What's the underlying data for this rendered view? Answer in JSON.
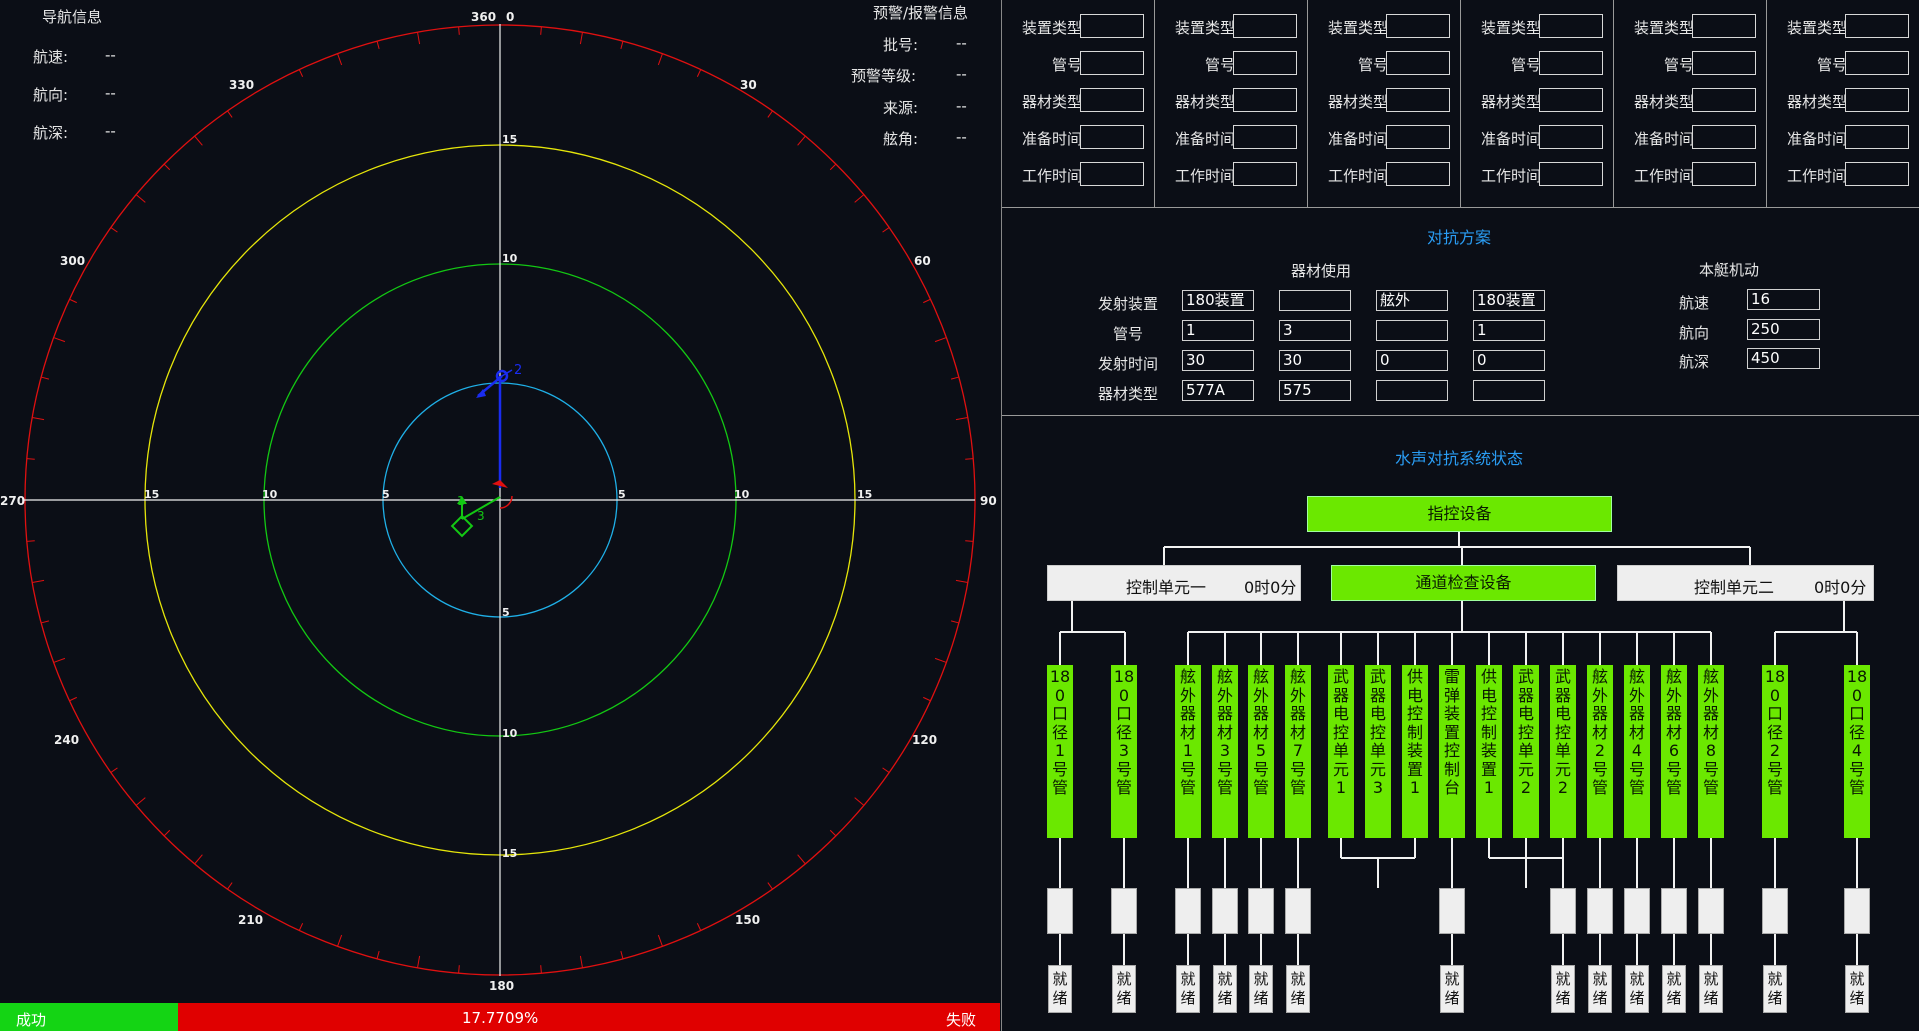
{
  "nav": {
    "title": "导航信息",
    "speed_label": "航速:",
    "speed_value": "--",
    "heading_label": "航向:",
    "heading_value": "--",
    "depth_label": "航深:",
    "depth_value": "--"
  },
  "warn": {
    "title": "预警/报警信息",
    "batch_label": "批号:",
    "batch_value": "--",
    "level_label": "预警等级:",
    "level_value": "--",
    "source_label": "来源:",
    "source_value": "--",
    "angle_label": "舷角:",
    "angle_value": "--"
  },
  "radar": {
    "bearings": [
      "360",
      "0",
      "30",
      "60",
      "90",
      "120",
      "150",
      "180",
      "210",
      "240",
      "270",
      "300",
      "330"
    ],
    "ranges": [
      "5",
      "10",
      "15"
    ],
    "ring_colors": {
      "r5": "#1fb0e8",
      "r10": "#13c813",
      "r15": "#e6e60a",
      "outer": "#e01010"
    },
    "targets": {
      "blue_id": "2",
      "green_id_a": "1",
      "green_id_b": "3"
    }
  },
  "status": {
    "success": "成功",
    "percent": "17.7709%",
    "fail": "失败",
    "progress": 0.177709
  },
  "devices": {
    "labels": {
      "type": "装置类型",
      "tube": "管号",
      "equip": "器材类型",
      "prep": "准备时间",
      "work": "工作时间"
    },
    "count": 6
  },
  "plan": {
    "title": "对抗方案",
    "equip_use_title": "器材使用",
    "row_labels": [
      "发射装置",
      "管号",
      "发射时间",
      "器材类型"
    ],
    "columns": [
      [
        "180装置",
        "1",
        "30",
        "577A"
      ],
      [
        "",
        "3",
        "30",
        "575"
      ],
      [
        "舷外",
        "",
        "0",
        ""
      ],
      [
        "180装置",
        "1",
        "0",
        ""
      ]
    ],
    "maneuver_title": "本艇机动",
    "speed_label": "航速",
    "speed_value": "16",
    "heading_label": "航向",
    "heading_value": "250",
    "depth_label": "航深",
    "depth_value": "450"
  },
  "system": {
    "title": "水声对抗系统状态",
    "command": "指控设备",
    "unit1": "控制单元一",
    "unit1_time": "0时0分",
    "channel": "通道检查设备",
    "unit2": "控制单元二",
    "unit2_time": "0时0分",
    "leaves": [
      {
        "name": "180口径1号管",
        "ready": "就绪"
      },
      {
        "name": "180口径3号管",
        "ready": "就绪"
      },
      {
        "name": "舷外器材1号管",
        "ready": "就绪"
      },
      {
        "name": "舷外器材3号管",
        "ready": "就绪"
      },
      {
        "name": "舷外器材5号管",
        "ready": "就绪"
      },
      {
        "name": "舷外器材7号管",
        "ready": "就绪"
      },
      {
        "name": "武器电控单元1",
        "ready": ""
      },
      {
        "name": "武器电控单元3",
        "ready": ""
      },
      {
        "name": "供电控制装置1",
        "ready": ""
      },
      {
        "name": "雷弹装置控制台",
        "ready": "就绪"
      },
      {
        "name": "供电控制装置1",
        "ready": ""
      },
      {
        "name": "武器电控单元2",
        "ready": ""
      },
      {
        "name": "武器电控单元2",
        "ready": "就绪"
      },
      {
        "name": "舷外器材2号管",
        "ready": "就绪"
      },
      {
        "name": "舷外器材4号管",
        "ready": "就绪"
      },
      {
        "name": "舷外器材6号管",
        "ready": "就绪"
      },
      {
        "name": "舷外器材8号管",
        "ready": "就绪"
      },
      {
        "name": "180口径2号管",
        "ready": "就绪"
      },
      {
        "name": "180口径4号管",
        "ready": "就绪"
      }
    ]
  }
}
